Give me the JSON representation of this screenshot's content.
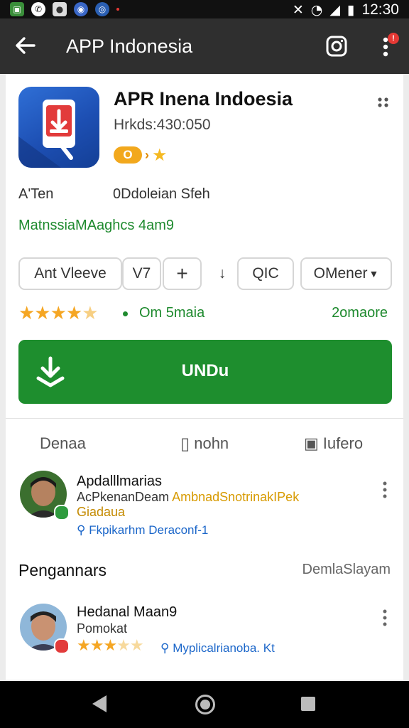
{
  "status_bar": {
    "time": "12:30",
    "icons": [
      "gallery-icon",
      "whatsapp-icon",
      "messenger-icon",
      "chrome-icon",
      "browser-icon",
      "mute-icon",
      "wifi-icon",
      "signal-icon",
      "battery-icon"
    ]
  },
  "app_bar": {
    "title": "APP Indonesia",
    "notification_count": "!"
  },
  "app": {
    "name": "APR Inena Indoesia",
    "subtitle": "Hrkds:430:050",
    "badge_text": "O",
    "meta_left": "A'Ten",
    "meta_right": "0Ddoleian Sfeh",
    "green_line": "MatnssiaMAaghcs 4am9"
  },
  "chips": {
    "chip1": "Ant Vleeve",
    "chip2": "V7",
    "chip3": "+",
    "chip4": "↓",
    "chip5": "QIC",
    "chip6": "OMener"
  },
  "rating": {
    "stars": 4.5,
    "middle": "Om 5maia",
    "right": "2omaore"
  },
  "install": {
    "label": "UNDu"
  },
  "tabs": {
    "tab1": "Denaa",
    "tab2": "nohn",
    "tab3": "Iufero"
  },
  "reviews": [
    {
      "name": "Apdalllmarias",
      "line1": "AcPkenanDeam",
      "tag": "AmbnadSnotrinakIPek",
      "line2": "Giadaua",
      "link": "Fkpikarhm Deraconf-1"
    },
    {
      "name": "Hedanal Maan9",
      "line1": "Pomokat",
      "stars": 3.5,
      "link": "Myplicalrianoba. Kt"
    }
  ],
  "section": {
    "title": "Pengannars",
    "right": "DemlaSlayam"
  },
  "colors": {
    "app_bar": "#2f2f2f",
    "install_green": "#1e8e2e",
    "accent_green": "#1e8a2e",
    "star": "#f5a623",
    "link": "#1b66c9"
  }
}
